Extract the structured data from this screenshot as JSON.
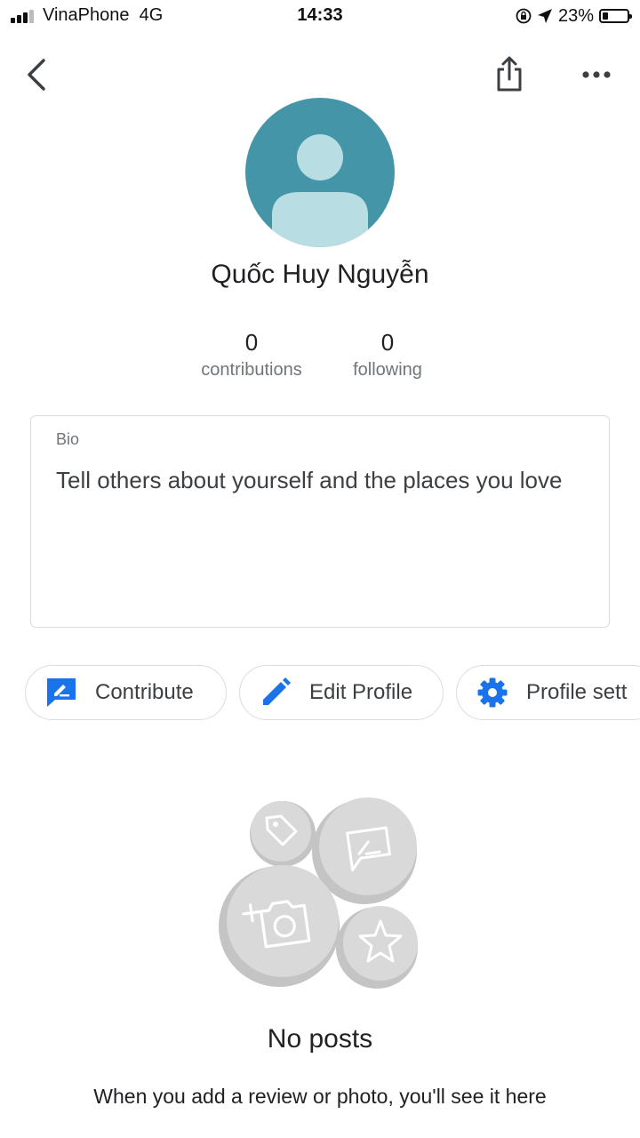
{
  "status_bar": {
    "carrier": "VinaPhone",
    "network": "4G",
    "time": "14:33",
    "battery": "23%",
    "battery_level": 0.23,
    "icons": [
      "signal-icon",
      "rotation-lock-icon",
      "location-arrow-icon",
      "battery-icon"
    ]
  },
  "nav": {
    "icons": [
      "back-chevron-icon",
      "share-icon",
      "more-horizontal-icon"
    ]
  },
  "profile": {
    "name": "Quốc Huy Nguyễn",
    "avatar_color": "#4495a7",
    "contributions_count": "0",
    "contributions_label": "contributions",
    "following_count": "0",
    "following_label": "following"
  },
  "bio": {
    "label": "Bio",
    "placeholder": "Tell others about yourself and the places you love"
  },
  "actions": {
    "contribute": "Contribute",
    "edit_profile": "Edit Profile",
    "profile_settings": "Profile sett",
    "accent_color": "#1a73e8"
  },
  "empty_state": {
    "title": "No posts",
    "subtitle": "When you add a review or photo, you'll see it here",
    "icons": [
      "tag-icon",
      "review-icon",
      "add-photo-icon",
      "star-icon"
    ]
  }
}
